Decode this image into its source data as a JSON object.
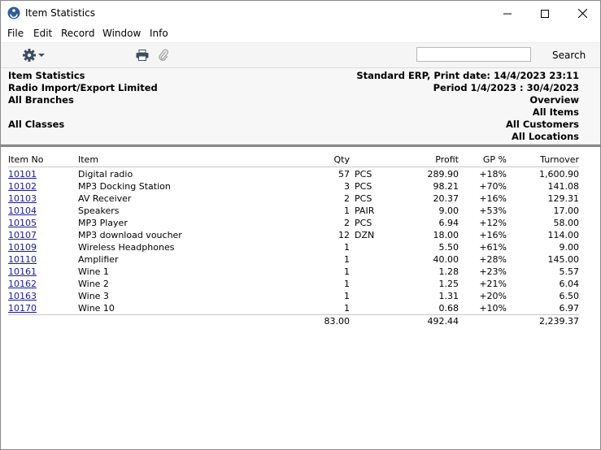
{
  "window": {
    "title": "Item Statistics",
    "icon": "app-logo-icon"
  },
  "menu": [
    "File",
    "Edit",
    "Record",
    "Window",
    "Info"
  ],
  "toolbar": {
    "search_value": "",
    "search_label": "Search"
  },
  "report": {
    "left": [
      "Item Statistics",
      "Radio Import/Export Limited",
      "All Branches",
      "All Classes"
    ],
    "company_print": "Standard ERP, Print date:  14/4/2023 23:11",
    "period": "Period  1/4/2023 : 30/4/2023",
    "right": [
      "Overview",
      "All Items",
      "All Customers",
      "All Locations"
    ]
  },
  "table": {
    "headers": {
      "item_no": "Item No",
      "item": "Item",
      "qty": "Qty",
      "profit": "Profit",
      "gp": "GP %",
      "turnover": "Turnover"
    },
    "rows": [
      {
        "no": "10101",
        "item": "Digital radio",
        "qty": "57",
        "unit": "PCS",
        "profit": "289.90",
        "gp": "+18%",
        "turnover": "1,600.90"
      },
      {
        "no": "10102",
        "item": "MP3 Docking Station",
        "qty": "3",
        "unit": "PCS",
        "profit": "98.21",
        "gp": "+70%",
        "turnover": "141.08"
      },
      {
        "no": "10103",
        "item": "AV Receiver",
        "qty": "2",
        "unit": "PCS",
        "profit": "20.37",
        "gp": "+16%",
        "turnover": "129.31"
      },
      {
        "no": "10104",
        "item": "Speakers",
        "qty": "1",
        "unit": "PAIR",
        "profit": "9.00",
        "gp": "+53%",
        "turnover": "17.00"
      },
      {
        "no": "10105",
        "item": "MP3 Player",
        "qty": "2",
        "unit": "PCS",
        "profit": "6.94",
        "gp": "+12%",
        "turnover": "58.00"
      },
      {
        "no": "10107",
        "item": "MP3 download voucher",
        "qty": "12",
        "unit": "DZN",
        "profit": "18.00",
        "gp": "+16%",
        "turnover": "114.00"
      },
      {
        "no": "10109",
        "item": "Wireless Headphones",
        "qty": "1",
        "unit": "",
        "profit": "5.50",
        "gp": "+61%",
        "turnover": "9.00"
      },
      {
        "no": "10110",
        "item": "Amplifier",
        "qty": "1",
        "unit": "",
        "profit": "40.00",
        "gp": "+28%",
        "turnover": "145.00"
      },
      {
        "no": "10161",
        "item": "Wine 1",
        "qty": "1",
        "unit": "",
        "profit": "1.28",
        "gp": "+23%",
        "turnover": "5.57"
      },
      {
        "no": "10162",
        "item": "Wine 2",
        "qty": "1",
        "unit": "",
        "profit": "1.25",
        "gp": "+21%",
        "turnover": "6.04"
      },
      {
        "no": "10163",
        "item": "Wine 3",
        "qty": "1",
        "unit": "",
        "profit": "1.31",
        "gp": "+20%",
        "turnover": "6.50"
      },
      {
        "no": "10170",
        "item": "Wine 10",
        "qty": "1",
        "unit": "",
        "profit": "0.68",
        "gp": "+10%",
        "turnover": "6.97"
      }
    ],
    "totals": {
      "qty": "83.00",
      "profit": "492.44",
      "turnover": "2,239.37"
    }
  },
  "colors": {
    "link": "#1a1a9a",
    "header_bg": "#f7f7f7",
    "toolbar_bg": "#f5f5f5",
    "logo_blue": "#2f5d93"
  }
}
